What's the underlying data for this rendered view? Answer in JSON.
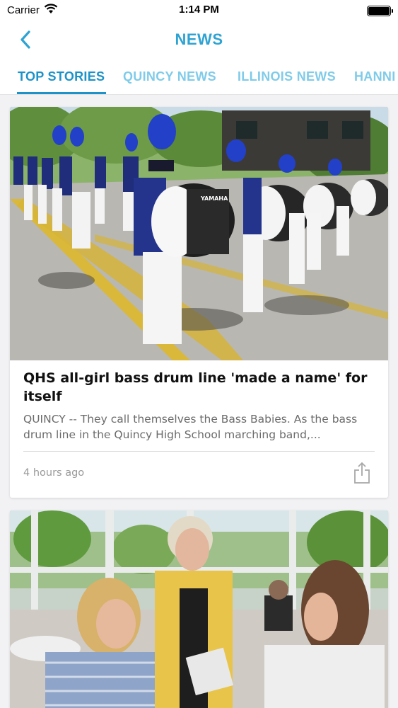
{
  "status_bar": {
    "carrier": "Carrier",
    "time": "1:14 PM",
    "battery_level": 1.0
  },
  "nav": {
    "title": "NEWS",
    "back_icon": "chevron-left-icon"
  },
  "tabs": [
    {
      "label": "TOP STORIES",
      "active": true
    },
    {
      "label": "QUINCY NEWS",
      "active": false
    },
    {
      "label": "ILLINOIS NEWS",
      "active": false
    },
    {
      "label": "HANNI",
      "active": false
    }
  ],
  "articles": [
    {
      "headline": "QHS all-girl bass drum line 'made a name' for itself",
      "summary": "QUINCY -- They call themselves the Bass Babies. As the bass drum line in the Quincy High School marching band,...",
      "timestamp": "4 hours ago",
      "image_subject": "marching band bass drum line on street",
      "drum_brand": "YAMAHA"
    },
    {
      "image_subject": "three women talking at a table by windows"
    }
  ],
  "colors": {
    "accent": "#1d92c8",
    "accent_light": "#7fcbe9",
    "title": "#2ea3d3",
    "feed_bg": "#f2f2f4"
  }
}
